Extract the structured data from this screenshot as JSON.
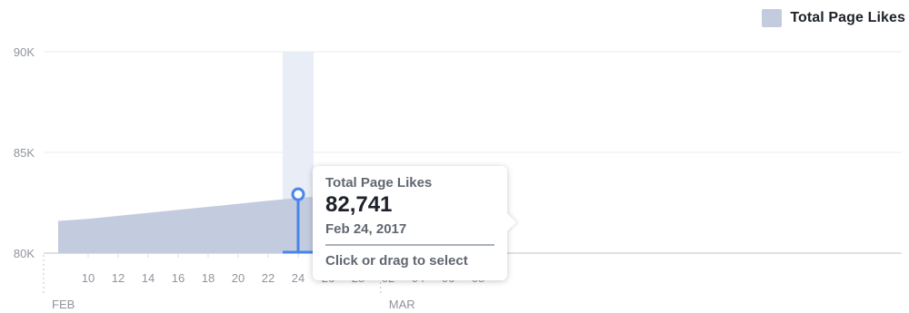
{
  "legend": {
    "label": "Total Page Likes",
    "color": "#c3cbdf"
  },
  "tooltip": {
    "series": "Total Page Likes",
    "value": "82,741",
    "date": "Feb 24, 2017",
    "hint": "Click or drag to select"
  },
  "chart_data": {
    "type": "area",
    "series": [
      {
        "name": "Total Page Likes",
        "x": [
          "2017-02-08",
          "2017-02-10",
          "2017-02-12",
          "2017-02-14",
          "2017-02-16",
          "2017-02-18",
          "2017-02-20",
          "2017-02-22",
          "2017-02-24",
          "2017-02-26",
          "2017-02-28",
          "2017-03-02",
          "2017-03-04",
          "2017-03-06",
          "2017-03-08",
          "2017-03-09"
        ],
        "y": [
          81600,
          81700,
          81850,
          82000,
          82150,
          82300,
          82450,
          82600,
          82741,
          82850,
          83000,
          83250,
          83350,
          83450,
          83600,
          83650
        ]
      }
    ],
    "yticks": [
      "80K",
      "85K",
      "90K"
    ],
    "yvalues": [
      80000,
      85000,
      90000
    ],
    "ylim": [
      80000,
      90000
    ],
    "xtick_labels": [
      "10",
      "12",
      "14",
      "16",
      "18",
      "20",
      "22",
      "24",
      "26",
      "28",
      "02",
      "04",
      "06",
      "08"
    ],
    "month_labels": [
      "FEB",
      "MAR"
    ],
    "selected_x": "2017-02-24",
    "selected_y": 82741,
    "grid": true,
    "colors": {
      "fill": "#c3cbdf",
      "highlight": "#4a86e8",
      "band": "#e8edf6",
      "grid": "#e9ebee",
      "axis_text": "#90949c"
    }
  }
}
